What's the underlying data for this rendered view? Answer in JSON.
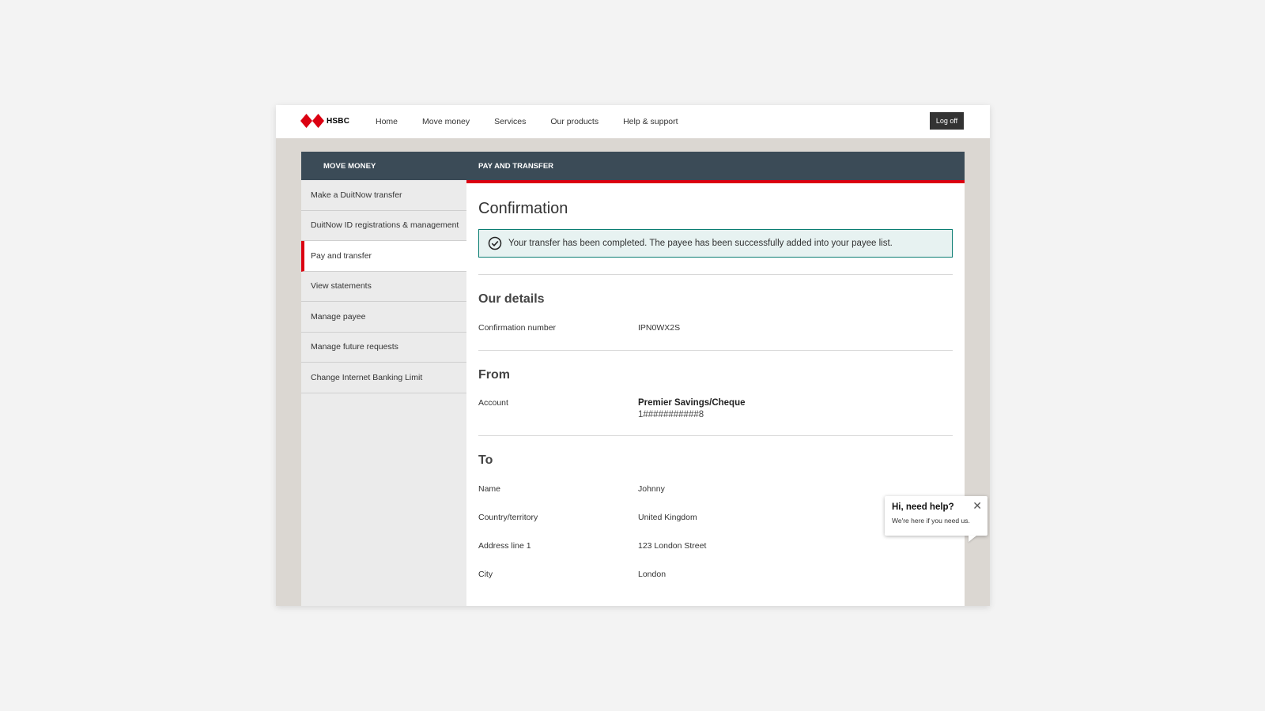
{
  "header": {
    "logo_text": "HSBC",
    "nav": [
      "Home",
      "Move money",
      "Services",
      "Our products",
      "Help & support"
    ],
    "logoff_label": "Log off"
  },
  "sidebar": {
    "title": "MOVE MONEY",
    "items": [
      {
        "label": "Make a DuitNow transfer"
      },
      {
        "label": "DuitNow ID registrations & management"
      },
      {
        "label": "Pay and transfer"
      },
      {
        "label": "View statements"
      },
      {
        "label": "Manage payee"
      },
      {
        "label": "Manage future requests"
      },
      {
        "label": "Change Internet Banking Limit"
      }
    ]
  },
  "main": {
    "header": "PAY AND TRANSFER",
    "title": "Confirmation",
    "success_message": "Your transfer has been completed. The payee has been successfully added into your payee list.",
    "our_details": {
      "title": "Our details",
      "label": "Confirmation number",
      "value": "IPN0WX2S"
    },
    "from": {
      "title": "From",
      "label": "Account",
      "account_name": "Premier Savings/Cheque",
      "account_number": "1###########8"
    },
    "to": {
      "title": "To",
      "rows": [
        {
          "label": "Name",
          "value": "Johnny"
        },
        {
          "label": "Country/territory",
          "value": "United Kingdom"
        },
        {
          "label": "Address line 1",
          "value": "123 London Street"
        },
        {
          "label": "City",
          "value": "London"
        }
      ]
    }
  },
  "help_popup": {
    "title": "Hi, need help?",
    "text": "We're here if you need us."
  },
  "colors": {
    "brand_red": "#db0011",
    "header_dark": "#3b4b57",
    "success_green": "#0a7d72"
  }
}
